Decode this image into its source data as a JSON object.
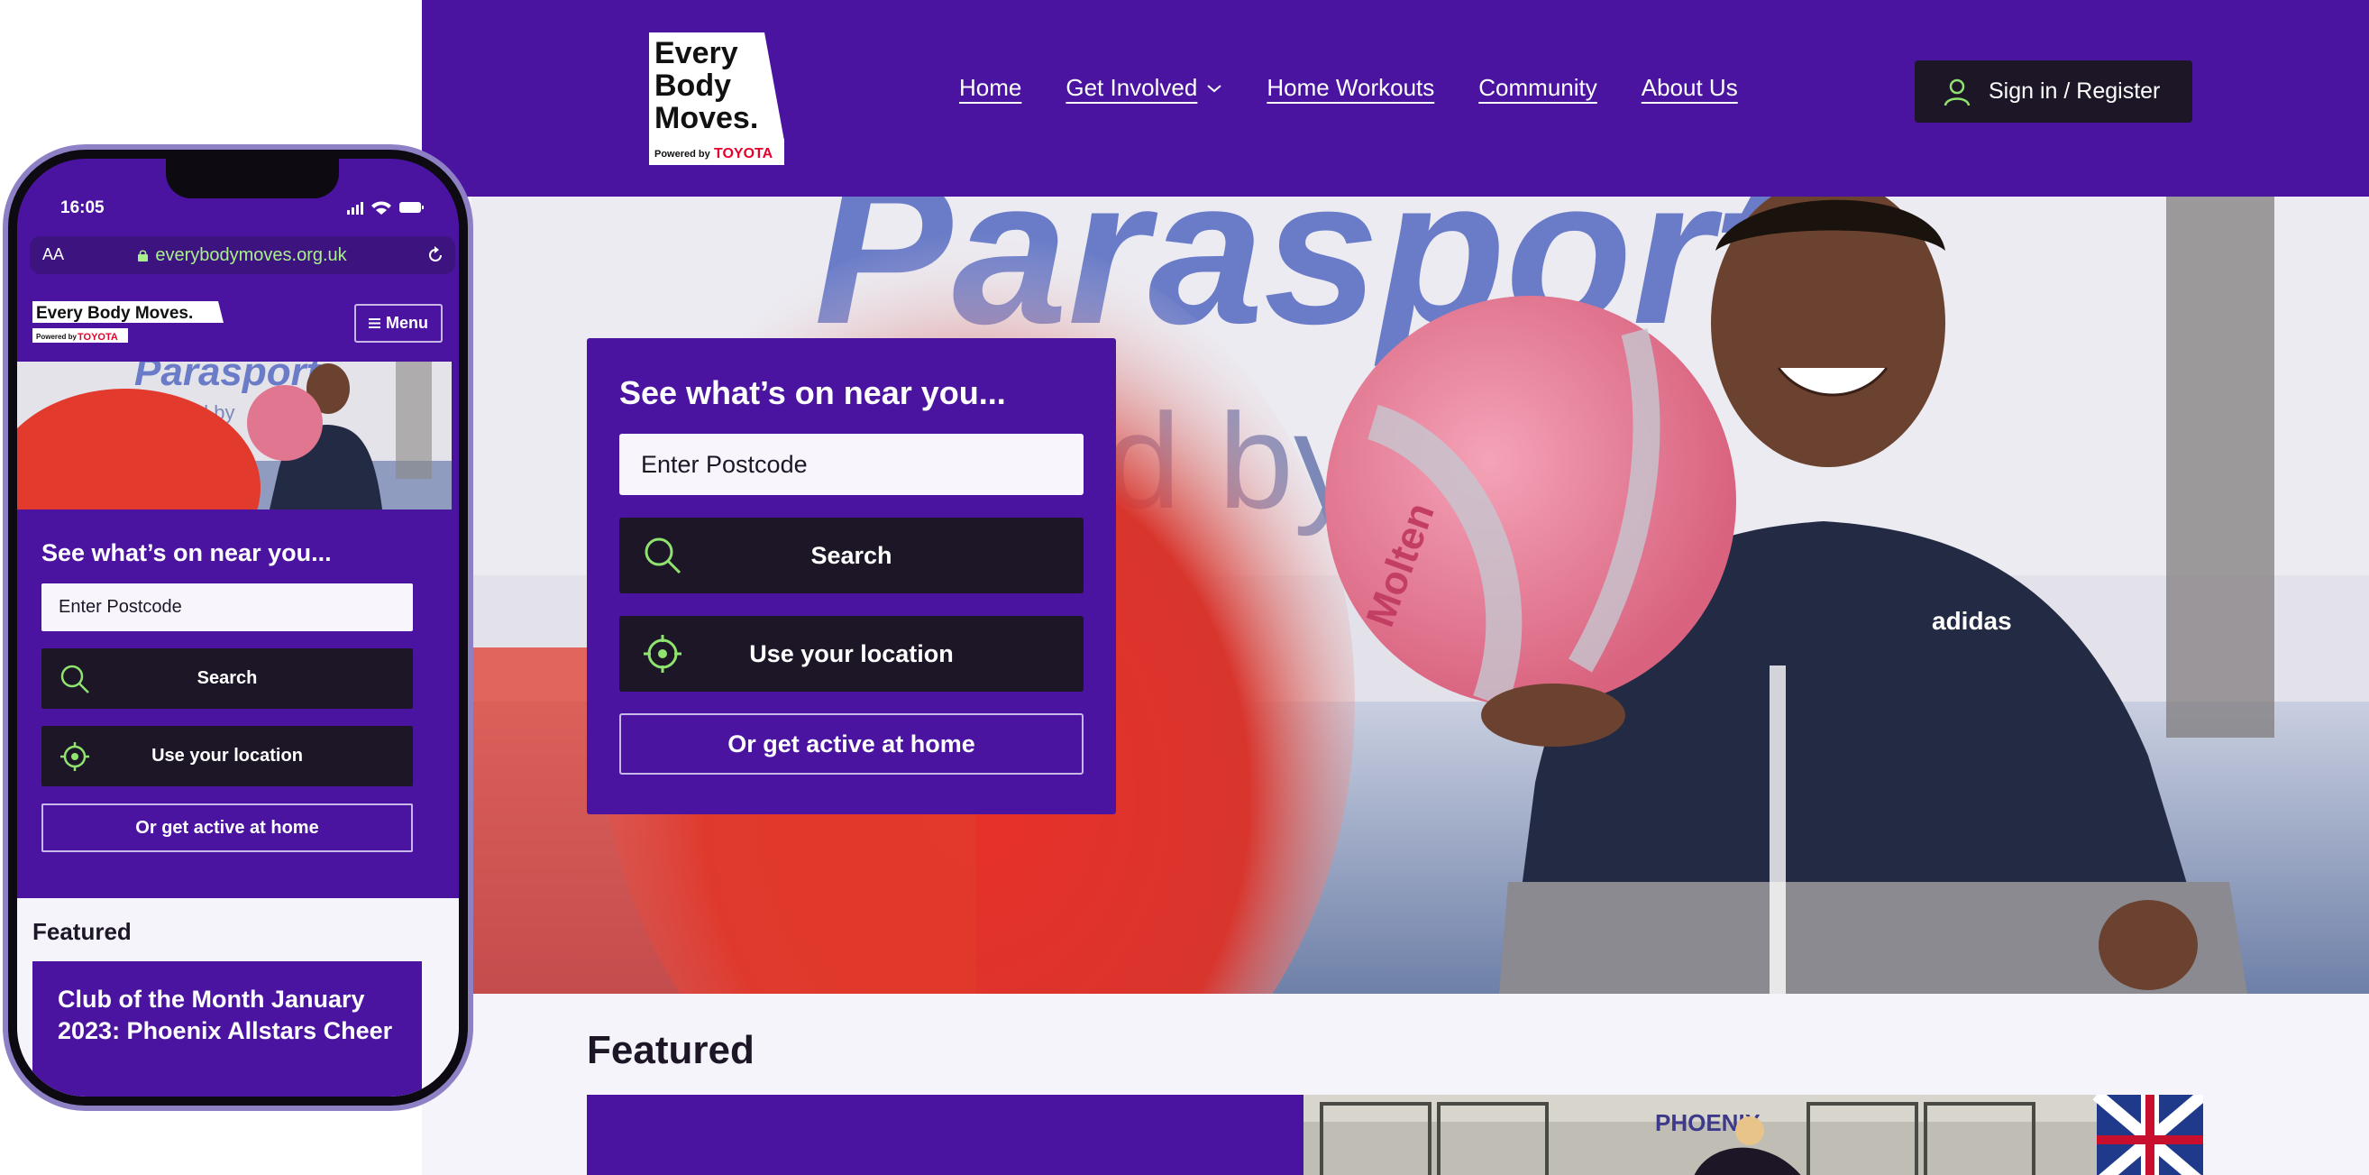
{
  "brand": {
    "logo_line1": "Every",
    "logo_line2": "Body",
    "logo_line3": "Moves.",
    "logo_powered": "Powered by",
    "logo_toyota": "TOYOTA",
    "colors": {
      "purple": "#4a14a0",
      "dark": "#1d1626",
      "green_icon": "#8fe36f",
      "toyota_red": "#e5002b"
    }
  },
  "desktop": {
    "nav": [
      {
        "label": "Home"
      },
      {
        "label": "Get Involved",
        "icon": "chevron-down-icon"
      },
      {
        "label": "Home Workouts"
      },
      {
        "label": "Community"
      },
      {
        "label": "About Us"
      }
    ],
    "signin_label": "Sign in / Register",
    "hero": {
      "banner_text": "Parasport",
      "banner_sub": "ed by",
      "ball_text": "Molten",
      "shirt_logo": "adidas"
    },
    "search_panel": {
      "title": "See what’s on near you...",
      "postcode_placeholder": "Enter Postcode",
      "search_label": "Search",
      "location_label": "Use your location",
      "home_label": "Or get active at home"
    },
    "featured_heading": "Featured",
    "featured_image_banner": "PHOENIX"
  },
  "phone": {
    "time": "16:05",
    "aa": "AA",
    "url": "everybodymoves.org.uk",
    "logo_text": "Every Body Moves.",
    "menu_label": "Menu",
    "hero_banner_text": "Parasport",
    "hero_banner_sub": "owered by",
    "search_panel": {
      "title": "See what’s on near you...",
      "postcode_placeholder": "Enter Postcode",
      "search_label": "Search",
      "location_label": "Use your location",
      "home_label": "Or get active at home"
    },
    "featured_heading": "Featured",
    "featured_card_title": "Club of the Month January 2023: Phoenix Allstars Cheer"
  }
}
